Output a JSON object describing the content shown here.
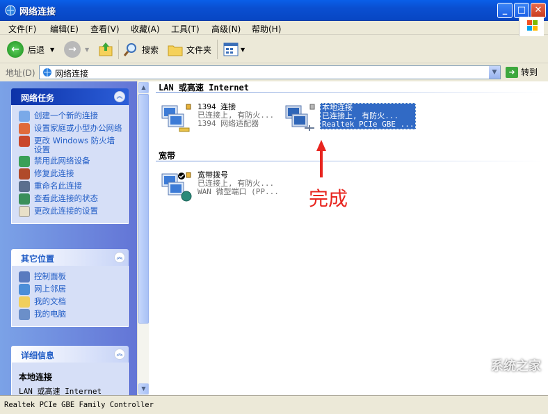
{
  "window": {
    "title": "网络连接"
  },
  "menu": [
    "文件(F)",
    "编辑(E)",
    "查看(V)",
    "收藏(A)",
    "工具(T)",
    "高级(N)",
    "帮助(H)"
  ],
  "toolbar": {
    "back": "后退",
    "search": "搜索",
    "folders": "文件夹"
  },
  "address": {
    "label": "地址(D)",
    "value": "网络连接",
    "go": "转到"
  },
  "tasks_panel": {
    "title": "网络任务",
    "items": [
      {
        "label": "创建一个新的连接",
        "icon": "new-connection-icon"
      },
      {
        "label": "设置家庭或小型办公网络",
        "icon": "home-network-icon"
      },
      {
        "label": "更改 Windows 防火墙设置",
        "icon": "firewall-icon"
      },
      {
        "label": "禁用此网络设备",
        "icon": "disable-device-icon"
      },
      {
        "label": "修复此连接",
        "icon": "repair-icon"
      },
      {
        "label": "重命名此连接",
        "icon": "rename-icon"
      },
      {
        "label": "查看此连接的状态",
        "icon": "status-icon"
      },
      {
        "label": "更改此连接的设置",
        "icon": "settings-icon"
      }
    ]
  },
  "places_panel": {
    "title": "其它位置",
    "items": [
      {
        "label": "控制面板",
        "icon": "control-panel-icon"
      },
      {
        "label": "网上邻居",
        "icon": "network-places-icon"
      },
      {
        "label": "我的文档",
        "icon": "my-documents-icon"
      },
      {
        "label": "我的电脑",
        "icon": "my-computer-icon"
      }
    ]
  },
  "details_panel": {
    "title": "详细信息",
    "name": "本地连接",
    "type": "LAN 或高速 Internet"
  },
  "groups": [
    {
      "title": "LAN 或高速 Internet",
      "connections": [
        {
          "name": "1394 连接",
          "status": "已连接上, 有防火...",
          "device": "1394 网络适配器",
          "selected": false
        },
        {
          "name": "本地连接",
          "status": "已连接上, 有防火...",
          "device": "Realtek PCIe GBE ...",
          "selected": true
        }
      ]
    },
    {
      "title": "宽带",
      "connections": [
        {
          "name": "宽带拨号",
          "status": "已连接上, 有防火...",
          "device": "WAN 微型端口 (PP...",
          "selected": false
        }
      ]
    }
  ],
  "annotation": "完成",
  "status_bar": "Realtek PCIe GBE Family Controller",
  "watermark": "系统之家",
  "colors": {
    "titlebar": "#0a5fe8",
    "selection": "#316ac5",
    "annotation": "#e8251f",
    "link": "#215dc6"
  }
}
